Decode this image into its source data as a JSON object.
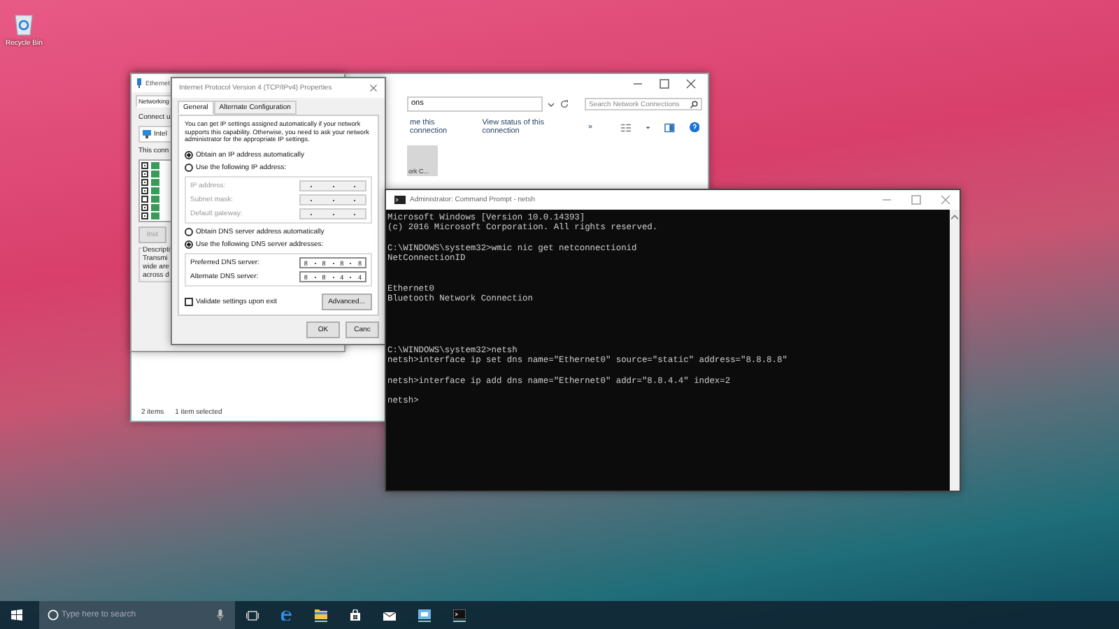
{
  "desktop": {
    "icons": [
      {
        "label": "Recycle Bin"
      }
    ]
  },
  "network_connections": {
    "address": "ons",
    "search": {
      "placeholder": "Search Network Connections"
    },
    "commands": [
      "me this connection",
      "View status of this connection",
      "»"
    ],
    "tile": {
      "label": "ork C...",
      "selected": true
    },
    "status_bar": [
      "2 items",
      "1 item selected"
    ]
  },
  "ethernet_properties": {
    "title": "Ethernet",
    "tabs": [
      {
        "label": "Networking",
        "selected": true
      }
    ],
    "connect_label": "Connect u",
    "adapter": "Intel",
    "list_label": "This conn",
    "items": [
      {
        "checked": true
      },
      {
        "checked": true
      },
      {
        "checked": true
      },
      {
        "checked": true
      },
      {
        "checked": false
      },
      {
        "checked": true
      },
      {
        "checked": true
      }
    ],
    "install_button": "Inst",
    "description_label": "Descripti",
    "description_lines": [
      "Transmi",
      "wide are",
      "across d"
    ]
  },
  "ipv4_dialog": {
    "title": "Internet Protocol Version 4 (TCP/IPv4) Properties",
    "tabs": [
      {
        "label": "General",
        "selected": true
      },
      {
        "label": "Alternate Configuration",
        "selected": false
      }
    ],
    "intro": "You can get IP settings assigned automatically if your network supports this capability. Otherwise, you need to ask your network administrator for the appropriate IP settings.",
    "ip_options": [
      {
        "label": "Obtain an IP address automatically",
        "selected": true
      },
      {
        "label": "Use the following IP address:",
        "selected": false
      }
    ],
    "ip_fields": [
      {
        "label": "IP address:",
        "disabled": true
      },
      {
        "label": "Subnet mask:",
        "disabled": true
      },
      {
        "label": "Default gateway:",
        "disabled": true
      }
    ],
    "dns_options": [
      {
        "label": "Obtain DNS server address automatically",
        "selected": false
      },
      {
        "label": "Use the following DNS server addresses:",
        "selected": true
      }
    ],
    "dns_fields": [
      {
        "label": "Preferred DNS server:",
        "disabled": false,
        "octets": [
          "8",
          "8",
          "8",
          "8"
        ]
      },
      {
        "label": "Alternate DNS server:",
        "disabled": false,
        "octets": [
          "8",
          "8",
          "4",
          "4"
        ]
      }
    ],
    "validate": {
      "label": "Validate settings upon exit",
      "checked": false
    },
    "advanced_button": "Advanced...",
    "buttons": [
      "OK",
      "Canc"
    ]
  },
  "command_prompt": {
    "title": "Administrator: Command Prompt - netsh",
    "lines": [
      {
        "kind": "text",
        "text": "Microsoft Windows [Version 10.0.14393]"
      },
      {
        "kind": "text",
        "text": "(c) 2016 Microsoft Corporation. All rights reserved."
      },
      {
        "kind": "blank"
      },
      {
        "kind": "text",
        "text": "C:\\WINDOWS\\system32>wmic nic get netconnectionid"
      },
      {
        "kind": "text",
        "text": "NetConnectionID"
      },
      {
        "kind": "blank"
      },
      {
        "kind": "blank"
      },
      {
        "kind": "text",
        "text": "Ethernet0"
      },
      {
        "kind": "text",
        "text": "Bluetooth Network Connection"
      },
      {
        "kind": "blank"
      },
      {
        "kind": "blank"
      },
      {
        "kind": "blank"
      },
      {
        "kind": "blank"
      },
      {
        "kind": "text",
        "text": "C:\\WINDOWS\\system32>netsh"
      },
      {
        "kind": "text",
        "text": "netsh>interface ip set dns name=\"Ethernet0\" source=\"static\" address=\"8.8.8.8\""
      },
      {
        "kind": "blank"
      },
      {
        "kind": "text",
        "text": "netsh>interface ip add dns name=\"Ethernet0\" addr=\"8.8.4.4\" index=2"
      },
      {
        "kind": "blank"
      },
      {
        "kind": "text",
        "text": "netsh>"
      }
    ]
  },
  "taskbar": {
    "search": {
      "placeholder": "Type here to search"
    }
  }
}
